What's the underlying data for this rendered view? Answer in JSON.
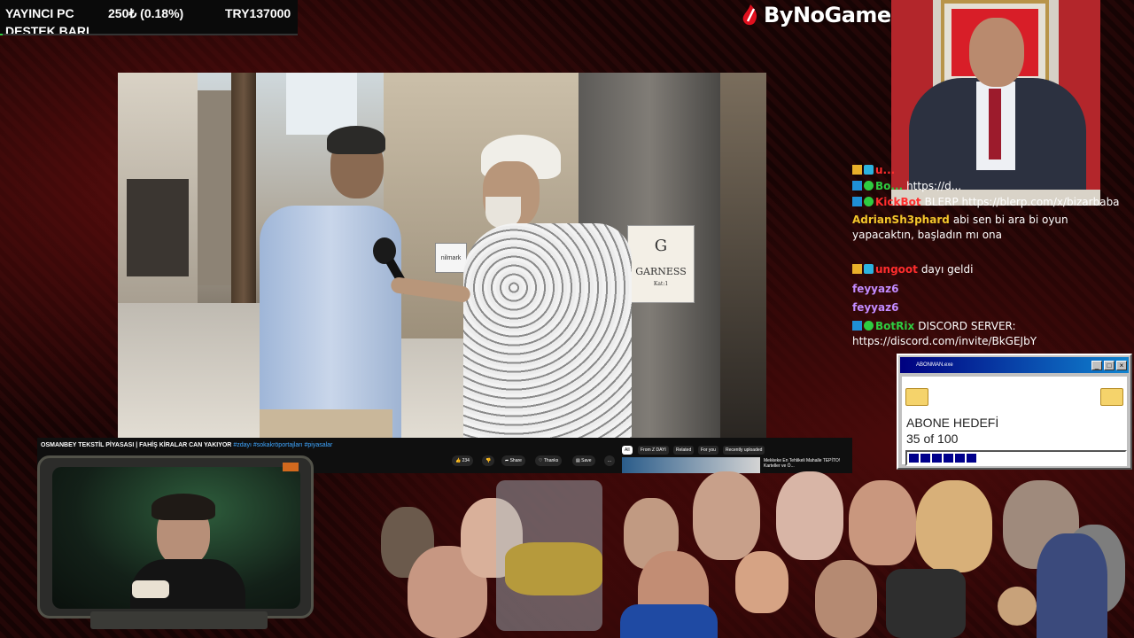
{
  "support_bar": {
    "title": "YAYINCI PC",
    "amount": "250₺ (0.18%)",
    "goal": "TRY137000",
    "label": "DESTEK BARI",
    "progress_percent": 0.18
  },
  "logo": {
    "text": "ByNoGame",
    "icon": "flame-icon"
  },
  "video_player": {
    "title": "OSMANBEY TEKSTİL PİYASASI | FAHİŞ KİRALAR CAN YAKIYOR",
    "hashtags": "#zdayı #sokakröportajları #piyasalar",
    "scene_signs": [
      "GARNESS",
      "nilmark",
      "Kat:1"
    ],
    "actions": {
      "likes": "234",
      "share": "Share",
      "thanks": "Thanks",
      "save": "Save",
      "more": "..."
    },
    "chips": [
      "All",
      "From Z DAYI",
      "Related",
      "For you",
      "Recently uploaded"
    ],
    "recommended": {
      "title": "Mekkeke En Tehlikeli Mahalle TEPİTO! Karteller ve Ö..."
    }
  },
  "chat": {
    "messages": [
      {
        "user": "u...",
        "text": "",
        "user_color": "#ff2d2d",
        "badges": [
          "crown",
          "sq"
        ]
      },
      {
        "user": "Bo...",
        "text": "https://d...",
        "user_color": "#2ecc40",
        "badges": [
          "blue",
          "green"
        ]
      },
      {
        "user": "KickBot",
        "text": "BLERP https://blerp.com/x/bizarbaba",
        "user_color": "#ff2d2d",
        "badges": [
          "blue",
          "green"
        ]
      },
      {
        "user": "AdrianSh3phard",
        "text": "abi sen bi ara bi oyun yapacaktın, başladın mı ona",
        "user_color": "#f3c62b",
        "badges": []
      },
      {
        "user": "ungoot",
        "text": "dayı geldi",
        "user_color": "#ff2d2d",
        "badges": [
          "crown",
          "sq"
        ]
      },
      {
        "user": "feyyaz6",
        "text": "",
        "user_color": "#c28bff",
        "badges": []
      },
      {
        "user": "feyyaz6",
        "text": "",
        "user_color": "#c28bff",
        "badges": []
      },
      {
        "user": "BotRix",
        "text": "DISCORD SERVER: https://discord.com/invite/BkGEJbY",
        "user_color": "#2ecc40",
        "badges": [
          "blue",
          "green"
        ]
      }
    ]
  },
  "abone_window": {
    "title": "ABONMAN.exe",
    "label": "ABONE HEDEFİ",
    "count": "35 of 100",
    "progress_fraction": 0.35,
    "buttons": [
      "_",
      "□",
      "×"
    ]
  },
  "colors": {
    "background": "#1a0606",
    "youtube_link": "#3ea6ff",
    "progress_fill": "#00008b",
    "titlebar": "#000080"
  }
}
